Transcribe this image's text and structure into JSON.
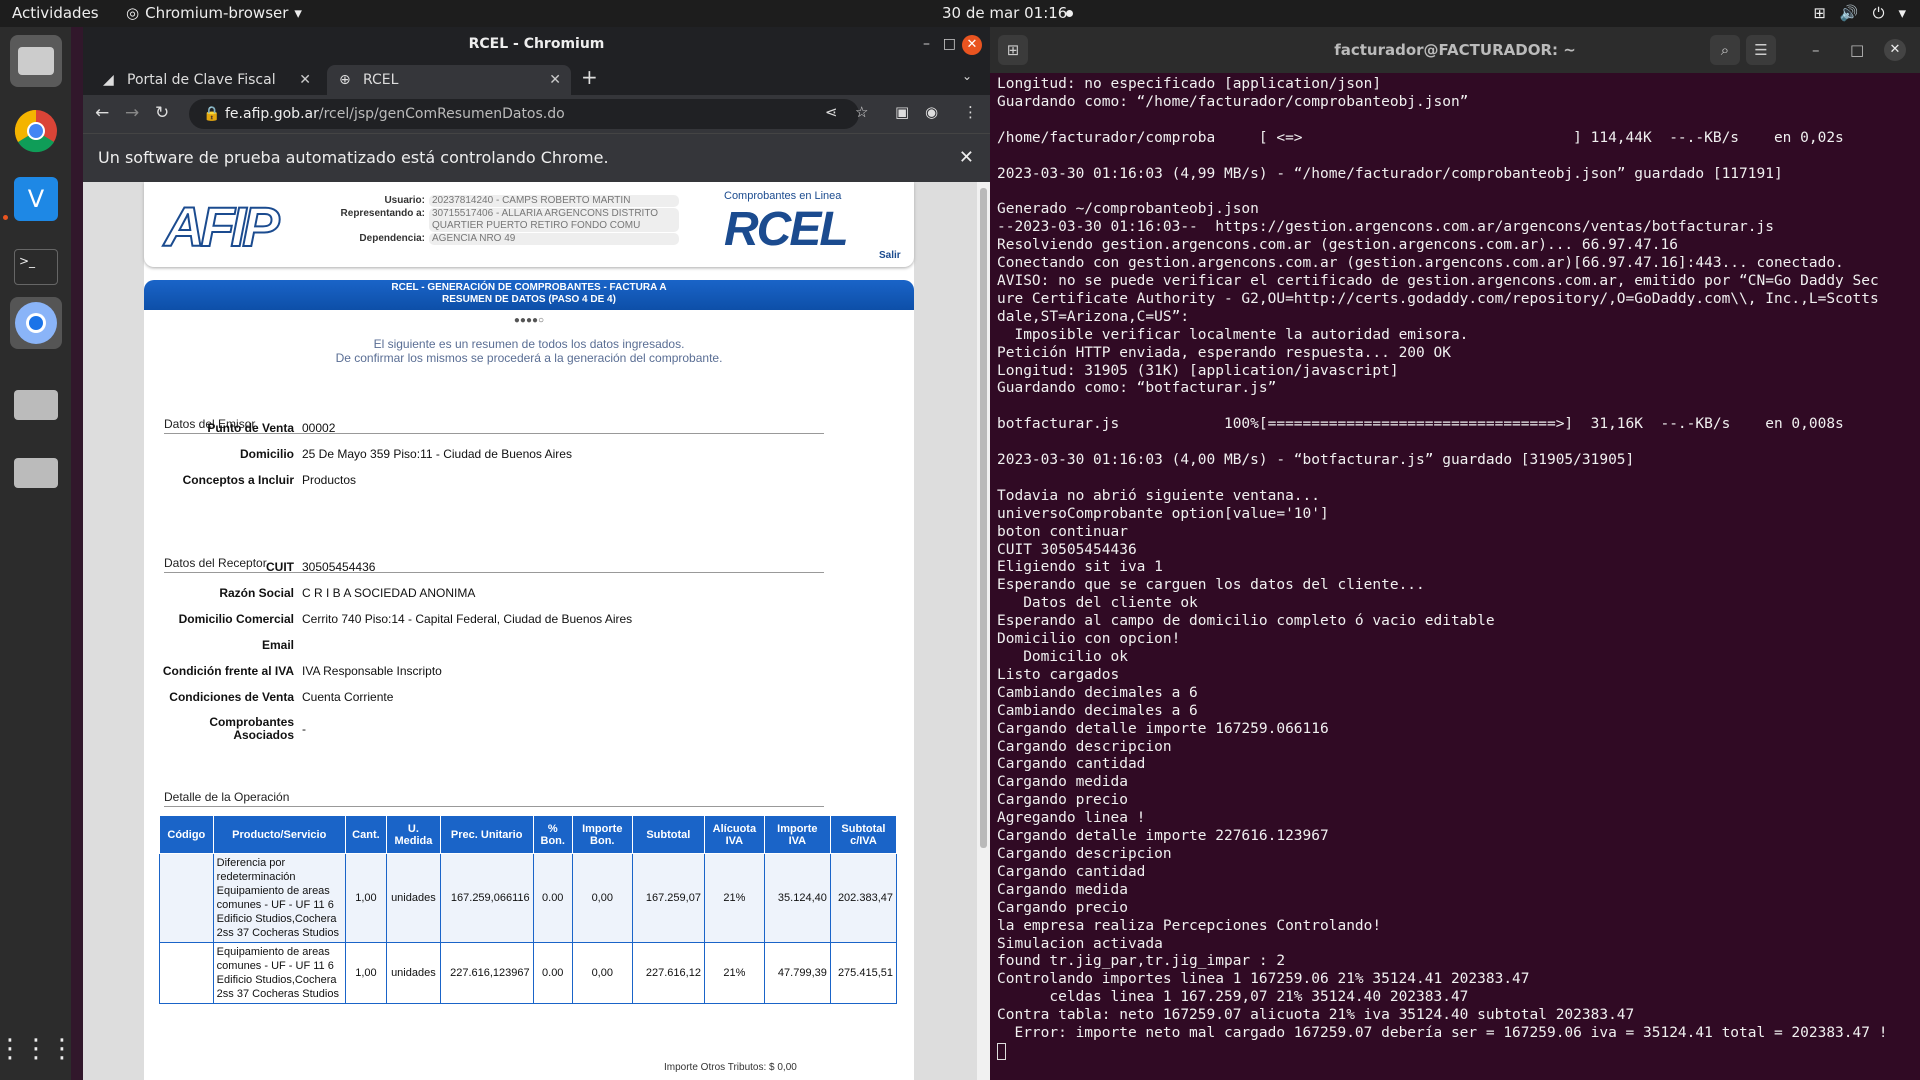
{
  "topbar": {
    "activities": "Actividades",
    "app": "Chromium-browser",
    "clock": "30 de mar  01:16"
  },
  "chrome": {
    "window_title": "RCEL - Chromium",
    "tabs": [
      {
        "label": "Portal de Clave Fiscal"
      },
      {
        "label": "RCEL"
      }
    ],
    "url_host": "fe.afip.gob.ar",
    "url_path": "/rcel/jsp/genComResumenDatos.do",
    "infobar": "Un software de prueba automatizado está controlando Chrome."
  },
  "page": {
    "user": {
      "usuario_label": "Usuario:",
      "usuario": "20237814240 - CAMPS ROBERTO MARTIN",
      "rep_label": "Representando a:",
      "rep": "30715517406 - ALLARIA ARGENCONS DISTRITO QUARTIER PUERTO RETIRO FONDO COMU",
      "dep_label": "Dependencia:",
      "dep": "AGENCIA NRO 49"
    },
    "logo_afip": "AFIP",
    "rcel_small": "Comprobantes en Linea",
    "rcel_logo": "RCEL",
    "salir": "Salir",
    "banner_l1": "RCEL - GENERACIÓN DE COMPROBANTES - FACTURA A",
    "banner_l2": "RESUMEN DE DATOS (PASO 4 DE 4)",
    "steps": "●●●●○",
    "intro_l1": "El siguiente es un resumen de todos los datos ingresados.",
    "intro_l2": "De confirmar los mismos se procederá a la generación del comprobante.",
    "emisor": {
      "title": "Datos del Emisor",
      "fields": [
        {
          "k": "Punto de Venta",
          "v": "00002"
        },
        {
          "k": "Domicilio",
          "v": "25 De Mayo 359 Piso:11 - Ciudad de Buenos Aires"
        },
        {
          "k": "Conceptos a Incluir",
          "v": "Productos"
        }
      ]
    },
    "receptor": {
      "title": "Datos del Receptor",
      "fields": [
        {
          "k": "CUIT",
          "v": "30505454436"
        },
        {
          "k": "Razón Social",
          "v": "C R I B A SOCIEDAD ANONIMA"
        },
        {
          "k": "Domicilio Comercial",
          "v": "Cerrito 740 Piso:14 - Capital Federal, Ciudad de Buenos Aires"
        },
        {
          "k": "Email",
          "v": ""
        },
        {
          "k": "Condición frente al IVA",
          "v": "IVA Responsable Inscripto"
        },
        {
          "k": "Condiciones de Venta",
          "v": "Cuenta Corriente"
        },
        {
          "k": "Comprobantes Asociados",
          "v": "-"
        }
      ]
    },
    "detalle": {
      "title": "Detalle de la Operación",
      "headers": [
        "Código",
        "Producto/Servicio",
        "Cant.",
        "U. Medida",
        "Prec. Unitario",
        "% Bon.",
        "Importe Bon.",
        "Subtotal",
        "Alícuota IVA",
        "Importe IVA",
        "Subtotal c/IVA"
      ],
      "rows": [
        [
          "",
          "Diferencia por redeterminación Equipamiento de areas comunes - UF - UF 11 6 Edificio Studios,Cochera 2ss 37 Cocheras Studios",
          "1,00",
          "unidades",
          "167.259,066116",
          "0.00",
          "0,00",
          "167.259,07",
          "21%",
          "35.124,40",
          "202.383,47"
        ],
        [
          "",
          "Equipamiento de areas comunes - UF - UF 11 6 Edificio Studios,Cochera 2ss 37 Cocheras Studios",
          "1,00",
          "unidades",
          "227.616,123967",
          "0.00",
          "0,00",
          "227.616,12",
          "21%",
          "47.799,39",
          "275.415,51"
        ]
      ]
    },
    "bottom_text": "Importe Otros Tributos: $   0,00"
  },
  "terminal": {
    "title": "facturador@FACTURADOR: ~",
    "lines": [
      "Longitud: no especificado [application/json]",
      "Guardando como: “/home/facturador/comprobanteobj.json”",
      "",
      "/home/facturador/comproba     [ <=>                               ] 114,44K  --.-KB/s    en 0,02s",
      "",
      "2023-03-30 01:16:03 (4,99 MB/s) - “/home/facturador/comprobanteobj.json” guardado [117191]",
      "",
      "Generado ~/comprobanteobj.json",
      "--2023-03-30 01:16:03--  https://gestion.argencons.com.ar/argencons/ventas/botfacturar.js",
      "Resolviendo gestion.argencons.com.ar (gestion.argencons.com.ar)... 66.97.47.16",
      "Conectando con gestion.argencons.com.ar (gestion.argencons.com.ar)[66.97.47.16]:443... conectado.",
      "AVISO: no se puede verificar el certificado de gestion.argencons.com.ar, emitido por “CN=Go Daddy Sec",
      "ure Certificate Authority - G2,OU=http://certs.godaddy.com/repository/,O=GoDaddy.com\\\\, Inc.,L=Scotts",
      "dale,ST=Arizona,C=US”:",
      "  Imposible verificar localmente la autoridad emisora.",
      "Petición HTTP enviada, esperando respuesta... 200 OK",
      "Longitud: 31905 (31K) [application/javascript]",
      "Guardando como: “botfacturar.js”",
      "",
      "botfacturar.js            100%[=================================>]  31,16K  --.-KB/s    en 0,008s",
      "",
      "2023-03-30 01:16:03 (4,00 MB/s) - “botfacturar.js” guardado [31905/31905]",
      "",
      "Todavia no abrió siguiente ventana...",
      "universoComprobante option[value='10']",
      "boton continuar",
      "CUIT 30505454436",
      "Eligiendo sit iva 1",
      "Esperando que se carguen los datos del cliente...",
      "   Datos del cliente ok",
      "Esperando al campo de domicilio completo ó vacio editable",
      "Domicilio con opcion!",
      "   Domicilio ok",
      "Listo cargados",
      "Cambiando decimales a 6",
      "Cambiando decimales a 6",
      "Cargando detalle importe 167259.066116",
      "Cargando descripcion",
      "Cargando cantidad",
      "Cargando medida",
      "Cargando precio",
      "Agregando linea !",
      "Cargando detalle importe 227616.123967",
      "Cargando descripcion",
      "Cargando cantidad",
      "Cargando medida",
      "Cargando precio",
      "la empresa realiza Percepciones Controlando!",
      "Simulacion activada",
      "found tr.jig_par,tr.jig_impar : 2",
      "Controlando importes linea 1 167259.06 21% 35124.41 202383.47",
      "      celdas linea 1 167.259,07 21% 35124.40 202383.47",
      "Contra tabla: neto 167259.07 alicuota 21% iva 35124.40 subtotal 202383.47",
      "  Error: importe neto mal cargado 167259.07 debería ser = 167259.06 iva = 35124.41 total = 202383.47 !"
    ]
  }
}
